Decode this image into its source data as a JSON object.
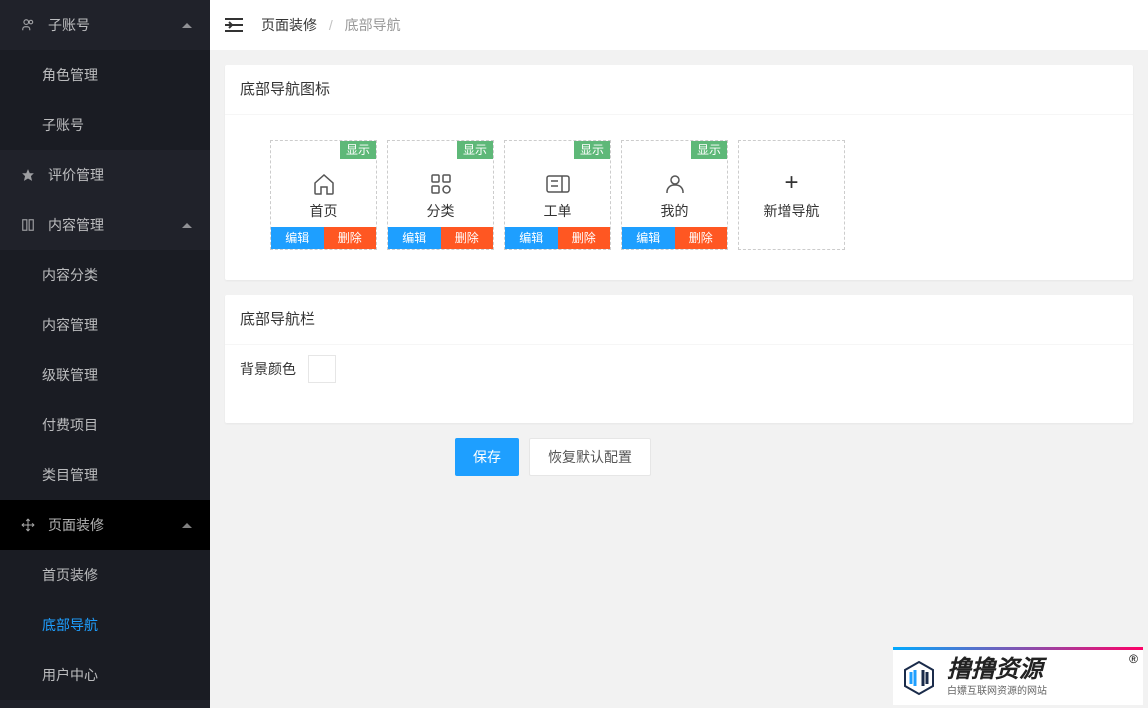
{
  "sidebar": {
    "sections": [
      {
        "label": "子账号",
        "icon": "user",
        "expanded": true,
        "children": [
          {
            "label": "角色管理"
          },
          {
            "label": "子账号"
          }
        ]
      },
      {
        "label": "评价管理",
        "icon": "star",
        "expanded": false,
        "children": []
      },
      {
        "label": "内容管理",
        "icon": "book",
        "expanded": true,
        "children": [
          {
            "label": "内容分类"
          },
          {
            "label": "内容管理"
          },
          {
            "label": "级联管理"
          },
          {
            "label": "付费项目"
          },
          {
            "label": "类目管理"
          }
        ]
      },
      {
        "label": "页面装修",
        "icon": "move",
        "expanded": true,
        "highlight": true,
        "children": [
          {
            "label": "首页装修"
          },
          {
            "label": "底部导航",
            "active": true
          },
          {
            "label": "用户中心"
          }
        ]
      }
    ]
  },
  "breadcrumb": {
    "root": "页面装修",
    "current": "底部导航"
  },
  "panels": {
    "icons_title": "底部导航图标",
    "bar_title": "底部导航栏",
    "bg_color_label": "背景颜色",
    "bg_color_value": "#ffffff"
  },
  "nav_items": [
    {
      "label": "首页",
      "icon": "home",
      "visible_badge": "显示",
      "edit": "编辑",
      "delete": "删除"
    },
    {
      "label": "分类",
      "icon": "grid",
      "visible_badge": "显示",
      "edit": "编辑",
      "delete": "删除"
    },
    {
      "label": "工单",
      "icon": "ticket",
      "visible_badge": "显示",
      "edit": "编辑",
      "delete": "删除"
    },
    {
      "label": "我的",
      "icon": "person",
      "visible_badge": "显示",
      "edit": "编辑",
      "delete": "删除"
    }
  ],
  "add_nav_label": "新增导航",
  "actions": {
    "save": "保存",
    "restore": "恢复默认配置"
  },
  "watermark": {
    "title": "撸撸资源",
    "subtitle": "白嫖互联网资源的网站"
  }
}
